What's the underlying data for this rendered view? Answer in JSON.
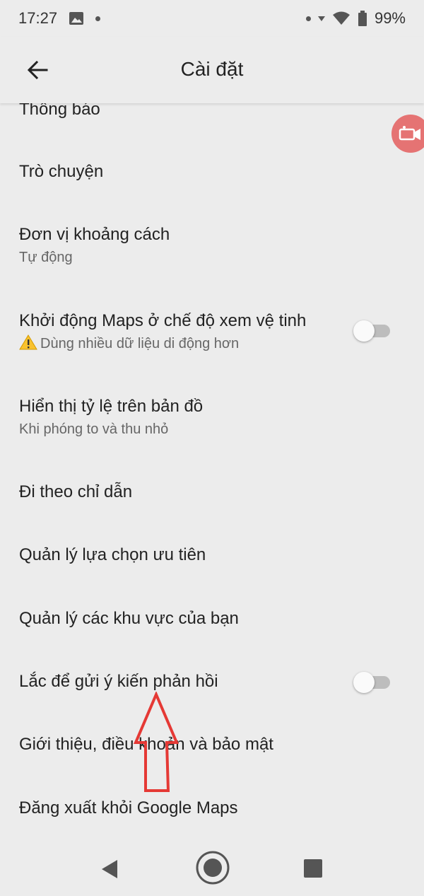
{
  "status_bar": {
    "time": "17:27",
    "battery": "99%",
    "icons": [
      "image-icon",
      "dot-icon",
      "dot-icon",
      "signal-icon",
      "wifi-icon",
      "battery-icon"
    ]
  },
  "app_bar": {
    "title": "Cài đặt",
    "back_icon": "arrow-left-icon"
  },
  "settings": {
    "items": [
      {
        "title": "Thông báo"
      },
      {
        "title": "Trò chuyện"
      },
      {
        "title": "Đơn vị khoảng cách",
        "subtitle": "Tự động"
      },
      {
        "title": "Khởi động Maps ở chế độ xem vệ tinh",
        "subtitle": "Dùng nhiều dữ liệu di động hơn",
        "toggle": false
      },
      {
        "title": "Hiển thị tỷ lệ trên bản đồ",
        "subtitle": "Khi phóng to và thu nhỏ"
      },
      {
        "title": "Đi theo chỉ dẫn"
      },
      {
        "title": "Quản lý lựa chọn ưu tiên"
      },
      {
        "title": "Quản lý các khu vực của bạn"
      },
      {
        "title": "Lắc để gửi ý kiến phản hồi",
        "toggle": false
      },
      {
        "title": "Giới thiệu, điều khoản và bảo mật"
      },
      {
        "title": "Đăng xuất khỏi Google Maps"
      }
    ]
  },
  "fab_icon": "video-camera-icon",
  "annotation": {
    "color": "#e53935",
    "shape": "up-arrow"
  },
  "nav_bar": {
    "icons": [
      "nav-back-icon",
      "nav-home-icon",
      "nav-recents-icon"
    ]
  },
  "colors": {
    "background": "#ececec",
    "fab": "#e57373",
    "toggle_off_track": "#bdbdbd"
  }
}
